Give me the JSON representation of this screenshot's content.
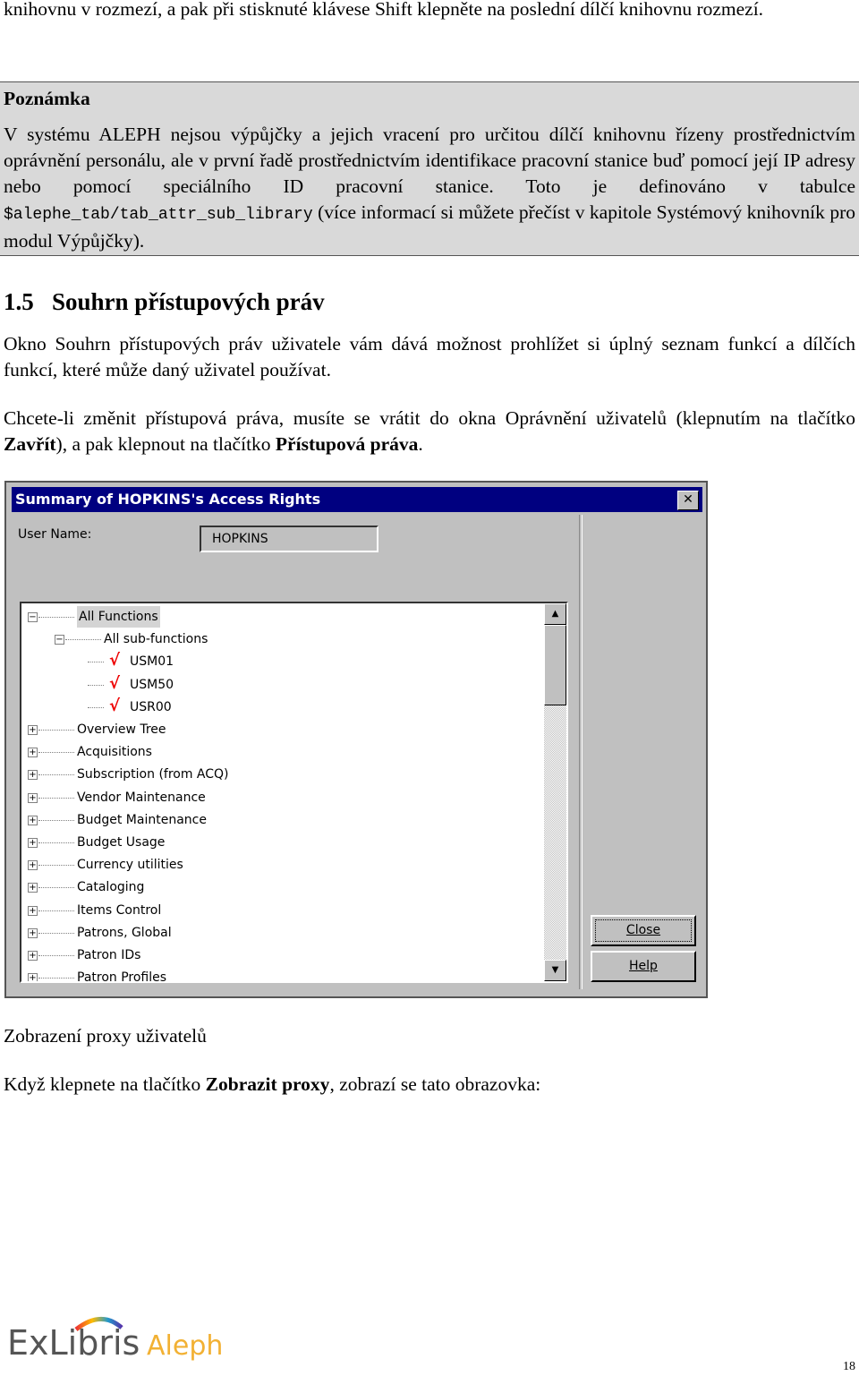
{
  "intro_tail": "knihovnu v rozmezí, a pak při stisknuté klávese Shift klepněte na poslední dílčí knihovnu rozmezí.",
  "note": {
    "heading": "Poznámka",
    "text_before": "V systému ALEPH nejsou výpůjčky a jejich vracení pro určitou dílčí knihovnu řízeny prostřednictvím oprávnění personálu, ale v první řadě prostřednictvím identifikace pracovní stanice buď pomocí její IP adresy nebo pomocí speciálního ID pracovní stanice. Toto je definováno v tabulce ",
    "code": "$alephe_tab/tab_attr_sub_library",
    "text_after": " (více informací si můžete přečíst v kapitole Systémový knihovník pro modul Výpůjčky)."
  },
  "section": {
    "number": "1.5",
    "title": "Souhrn přístupových práv",
    "para1": "Okno Souhrn přístupových práv uživatele vám dává možnost prohlížet si úplný seznam funkcí a dílčích funkcí, které může daný uživatel používat.",
    "para2_a": "Chcete-li změnit přístupová práva, musíte se vrátit do okna Oprávnění uživatelů (klepnutím na tlačítko ",
    "para2_b1": "Zavřít",
    "para2_c": "), a pak klepnout na tlačítko ",
    "para2_b2": "Přístupová práva",
    "para2_d": "."
  },
  "dialog": {
    "title": "Summary of HOPKINS's Access Rights",
    "close_x": "✕",
    "user_label": "User Name:",
    "user_value": "HOPKINS",
    "tree": [
      {
        "label": "All Functions",
        "level": 0,
        "state": "expanded"
      },
      {
        "label": "All sub-functions",
        "level": 1,
        "state": "expanded"
      },
      {
        "label": "USM01",
        "level": 2,
        "state": "checked"
      },
      {
        "label": "USM50",
        "level": 2,
        "state": "checked"
      },
      {
        "label": "USR00",
        "level": 2,
        "state": "checked"
      },
      {
        "label": "Overview Tree",
        "level": 0,
        "state": "collapsed"
      },
      {
        "label": "Acquisitions",
        "level": 0,
        "state": "collapsed"
      },
      {
        "label": "Subscription (from ACQ)",
        "level": 0,
        "state": "collapsed"
      },
      {
        "label": "Vendor Maintenance",
        "level": 0,
        "state": "collapsed"
      },
      {
        "label": "Budget Maintenance",
        "level": 0,
        "state": "collapsed"
      },
      {
        "label": "Budget Usage",
        "level": 0,
        "state": "collapsed"
      },
      {
        "label": "Currency utilities",
        "level": 0,
        "state": "collapsed"
      },
      {
        "label": "Cataloging",
        "level": 0,
        "state": "collapsed"
      },
      {
        "label": "Items Control",
        "level": 0,
        "state": "collapsed"
      },
      {
        "label": "Patrons, Global",
        "level": 0,
        "state": "collapsed"
      },
      {
        "label": "Patron IDs",
        "level": 0,
        "state": "collapsed"
      },
      {
        "label": "Patron Profiles",
        "level": 0,
        "state": "collapsed"
      }
    ],
    "close_button": "Close",
    "help_button": "Help"
  },
  "caption": "Zobrazení proxy uživatelů",
  "para3": {
    "a": "Když klepnete na tlačítko ",
    "b": "Zobrazit proxy",
    "c": ", zobrazí se tato obrazovka:"
  },
  "logo": {
    "ex": "ExLibris",
    "aleph": "Aleph"
  },
  "page_number": "18"
}
